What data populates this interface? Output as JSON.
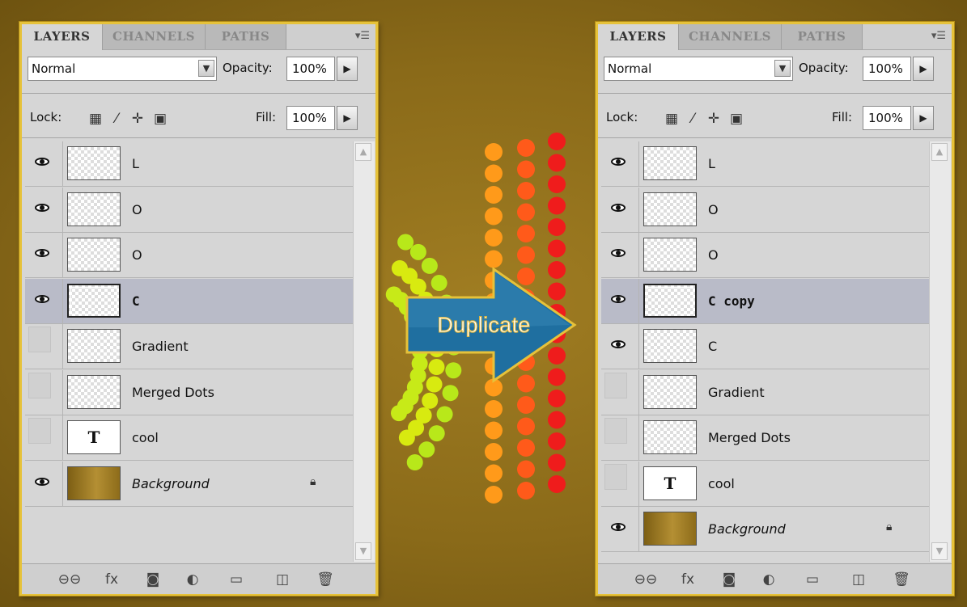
{
  "background": {
    "color": "#8f6e1b",
    "border_color": "#e6c23a"
  },
  "panels": [
    {
      "id": "left",
      "tabs": [
        "LAYERS",
        "CHANNELS",
        "PATHS"
      ],
      "blend_mode": "Normal",
      "opacity_label": "Opacity:",
      "opacity_value": "100%",
      "lock_label": "Lock:",
      "fill_label": "Fill:",
      "fill_value": "100%",
      "layers": [
        {
          "name": "L",
          "visible": true,
          "selected": false,
          "thumb": "transparent"
        },
        {
          "name": "O",
          "visible": true,
          "selected": false,
          "thumb": "transparent"
        },
        {
          "name": "O",
          "visible": true,
          "selected": false,
          "thumb": "transparent"
        },
        {
          "name": "C",
          "visible": true,
          "selected": true,
          "thumb": "transparent"
        },
        {
          "name": "Gradient",
          "visible": false,
          "selected": false,
          "thumb": "transparent"
        },
        {
          "name": "Merged Dots",
          "visible": false,
          "selected": false,
          "thumb": "transparent"
        },
        {
          "name": "cool",
          "visible": false,
          "selected": false,
          "thumb": "text",
          "thumb_text": "T"
        },
        {
          "name": "Background",
          "visible": true,
          "selected": false,
          "thumb": "background",
          "locked": true
        }
      ]
    },
    {
      "id": "right",
      "tabs": [
        "LAYERS",
        "CHANNELS",
        "PATHS"
      ],
      "blend_mode": "Normal",
      "opacity_label": "Opacity:",
      "opacity_value": "100%",
      "lock_label": "Lock:",
      "fill_label": "Fill:",
      "fill_value": "100%",
      "layers": [
        {
          "name": "L",
          "visible": true,
          "selected": false,
          "thumb": "transparent"
        },
        {
          "name": "O",
          "visible": true,
          "selected": false,
          "thumb": "transparent"
        },
        {
          "name": "O",
          "visible": true,
          "selected": false,
          "thumb": "transparent"
        },
        {
          "name": "C copy",
          "visible": true,
          "selected": true,
          "thumb": "transparent"
        },
        {
          "name": "C",
          "visible": true,
          "selected": false,
          "thumb": "transparent"
        },
        {
          "name": "Gradient",
          "visible": false,
          "selected": false,
          "thumb": "transparent"
        },
        {
          "name": "Merged Dots",
          "visible": false,
          "selected": false,
          "thumb": "transparent"
        },
        {
          "name": "cool",
          "visible": false,
          "selected": false,
          "thumb": "text",
          "thumb_text": "T"
        },
        {
          "name": "Background",
          "visible": true,
          "selected": false,
          "thumb": "background",
          "locked": true
        }
      ]
    }
  ],
  "callout": {
    "text": "Duplicate",
    "fill": "#1f6fa0",
    "stroke": "#e6c23a"
  },
  "icons": {
    "lock_icons": [
      "lock-transparent-pixels-icon",
      "lock-image-pixels-icon",
      "lock-position-icon",
      "lock-all-icon"
    ],
    "bottom_icons": [
      "link-layers-icon",
      "layer-style-icon",
      "layer-mask-icon",
      "adjustment-layer-icon",
      "new-group-icon",
      "new-layer-icon",
      "delete-layer-icon"
    ]
  }
}
